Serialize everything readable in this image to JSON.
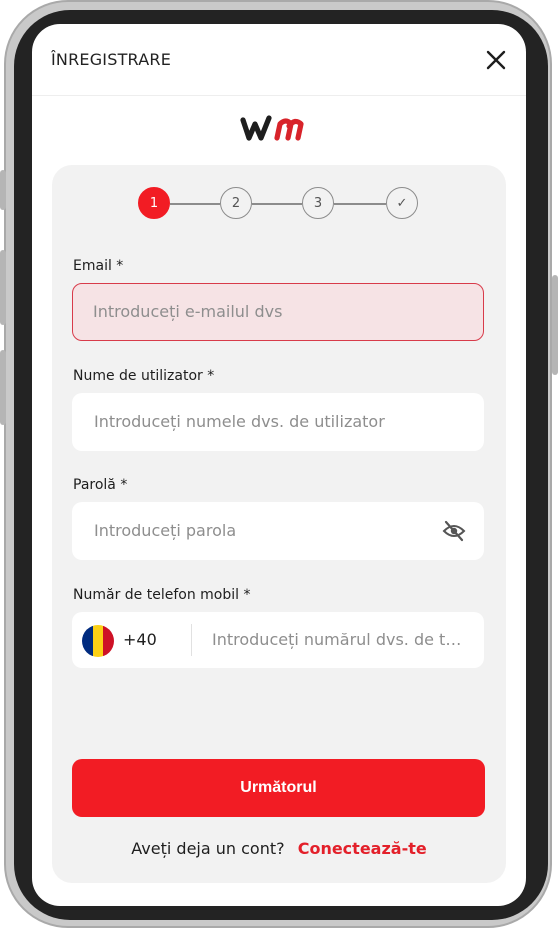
{
  "header": {
    "title": "ÎNREGISTRARE",
    "close_icon": "close-icon"
  },
  "logo": {
    "text": "wm",
    "color": "#d8232a"
  },
  "stepper": {
    "steps": [
      {
        "label": "1",
        "active": true
      },
      {
        "label": "2",
        "active": false
      },
      {
        "label": "3",
        "active": false
      },
      {
        "label": "✓",
        "active": false
      }
    ]
  },
  "form": {
    "email": {
      "label": "Email *",
      "placeholder": "Introduceți e-mailul dvs",
      "value": "",
      "state": "error"
    },
    "username": {
      "label": "Nume de utilizator *",
      "placeholder": "Introduceți numele dvs. de utilizator",
      "value": ""
    },
    "password": {
      "label": "Parolă *",
      "placeholder": "Introduceți parola",
      "value": "",
      "toggle_icon": "eye-slash-icon"
    },
    "phone": {
      "label": "Număr de telefon mobil *",
      "country_icon": "romania-flag-icon",
      "dial_code": "+40",
      "placeholder": "Introduceți numărul dvs. de telefon",
      "value": ""
    }
  },
  "actions": {
    "next_label": "Următorul",
    "login_prompt": "Aveți deja un cont?",
    "login_link": "Conectează-te"
  },
  "colors": {
    "accent": "#f21c24",
    "error_border": "#d83b4a",
    "error_bg": "#f6e3e5",
    "card_bg": "#f2f2f2"
  }
}
